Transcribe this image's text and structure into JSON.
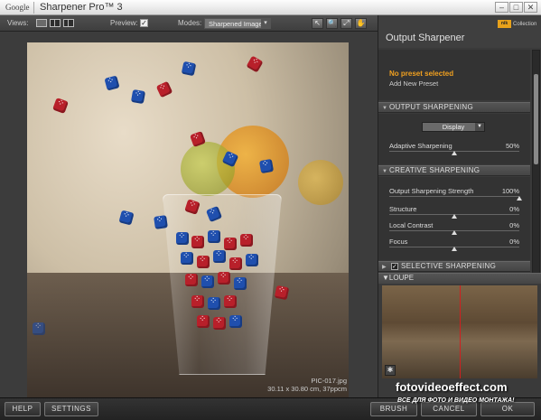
{
  "titlebar": {
    "brand": "Google",
    "app_name": "Sharpener Pro™",
    "version": "3",
    "minimize": "–",
    "maximize": "□",
    "close": "✕"
  },
  "toolbar": {
    "views_label": "Views:",
    "preview_label": "Preview:",
    "preview_checked": "✓",
    "modes_label": "Modes:",
    "mode_value": "Sharpened Image",
    "tools": [
      "↖",
      "🔍",
      "⤢",
      "✋"
    ]
  },
  "image": {
    "filename": "PIC-017.jpg",
    "dimensions": "30.11 x 30.80 cm, 37ppcm"
  },
  "panel": {
    "title": "Output Sharpener",
    "logo": "nik",
    "collection": "Collection",
    "preset_status": "No preset selected",
    "add_preset": "Add New Preset",
    "output_section": "OUTPUT SHARPENING",
    "output_type": "Display",
    "adaptive_label": "Adaptive Sharpening",
    "adaptive_value": "50%",
    "creative_section": "CREATIVE SHARPENING",
    "creative": [
      {
        "label": "Output Sharpening Strength",
        "value": "100%"
      },
      {
        "label": "Structure",
        "value": "0%"
      },
      {
        "label": "Local Contrast",
        "value": "0%"
      },
      {
        "label": "Focus",
        "value": "0%"
      }
    ],
    "selective_section": "SELECTIVE SHARPENING",
    "selective_checked": "✓",
    "loupe_section": "LOUPE"
  },
  "bottom": {
    "help": "HELP",
    "settings": "SETTINGS",
    "brush": "BRUSH",
    "cancel": "CANCEL",
    "ok": "OK"
  },
  "watermark": {
    "site": "fotovideoeffect.com",
    "tagline": "ВСЕ ДЛЯ ФОТО И ВИДЕО МОНТАЖА!"
  },
  "slider_levels": {
    "adaptive": 0.5,
    "strength": 1.0,
    "structure": 0.5,
    "local_contrast": 0.5,
    "focus": 0.5
  }
}
